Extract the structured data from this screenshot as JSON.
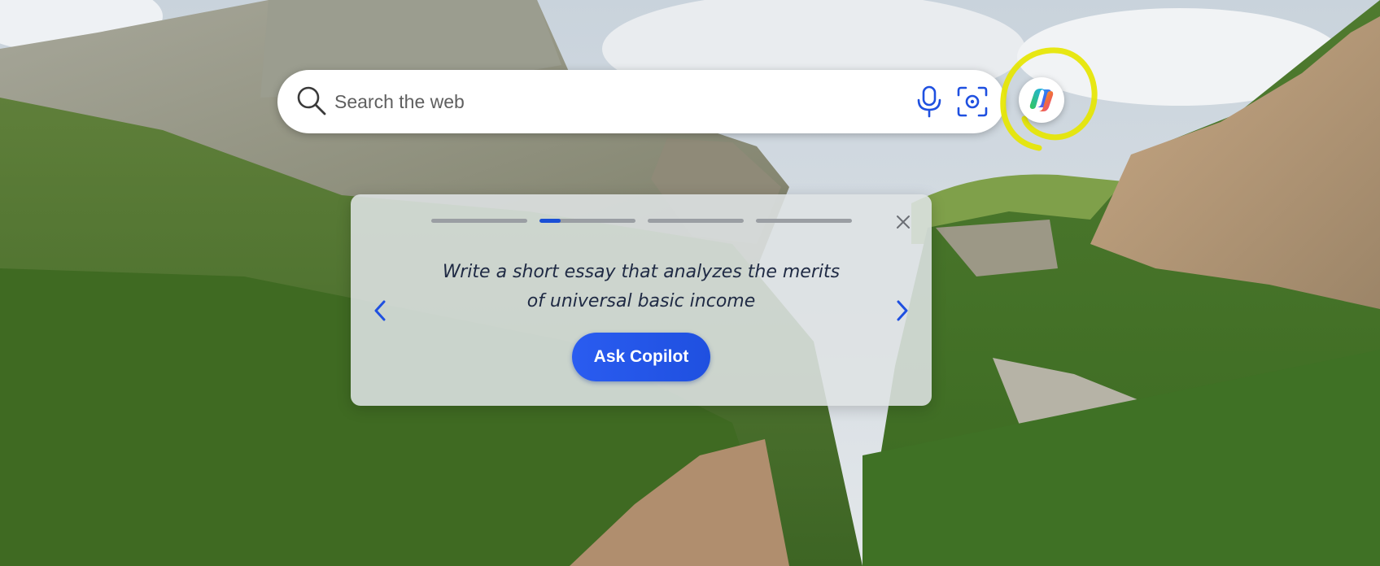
{
  "search": {
    "placeholder": "Search the web"
  },
  "icons": {
    "search": "search-icon",
    "microphone": "microphone-icon",
    "visual_search": "camera-icon",
    "copilot": "copilot-icon",
    "close": "close-icon",
    "previous": "chevron-left-icon",
    "next": "chevron-right-icon"
  },
  "suggestion_card": {
    "prompt_text": "Write a short essay that analyzes the merits of universal basic income",
    "cta_label": "Ask Copilot",
    "progress_steps": [
      {
        "fill": 0
      },
      {
        "fill": 0.22
      },
      {
        "fill": 0
      },
      {
        "fill": 0
      }
    ]
  },
  "colors": {
    "accent": "#1f50e0",
    "card_background": "#dee2e4",
    "highlight_annotation": "#e6e600"
  }
}
